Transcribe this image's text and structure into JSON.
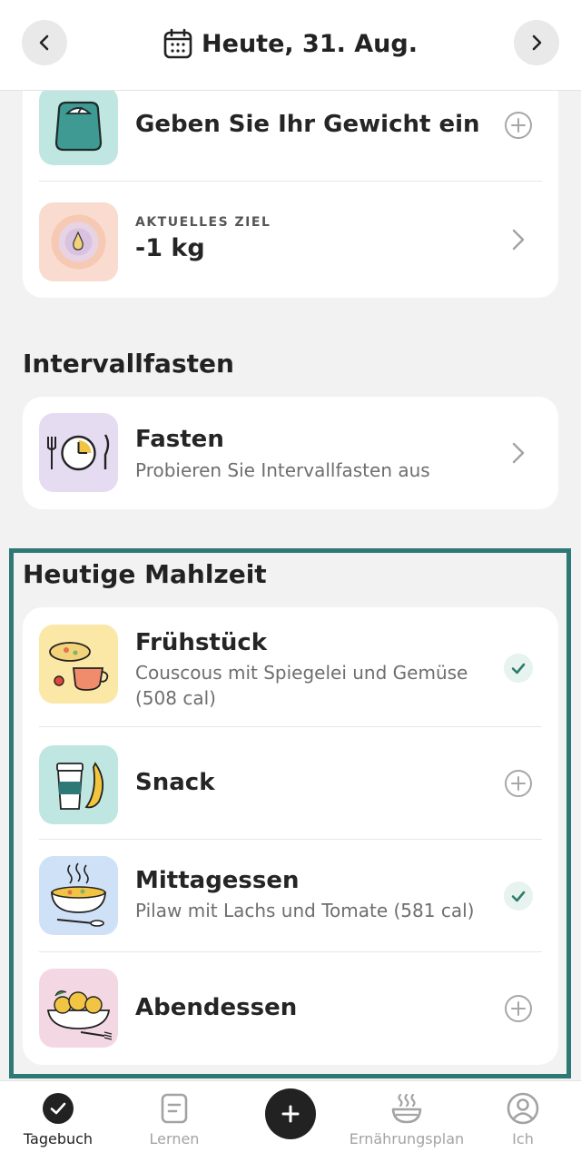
{
  "header": {
    "date_label": "Heute, 31. Aug."
  },
  "weight": {
    "enter_label": "Geben Sie Ihr Gewicht ein",
    "goal_kicker": "AKTUELLES ZIEL",
    "goal_value": "-1 kg"
  },
  "fasting": {
    "section_title": "Intervallfasten",
    "title": "Fasten",
    "subtitle": "Probieren Sie Intervallfasten aus"
  },
  "meals": {
    "section_title": "Heutige Mahlzeit",
    "items": [
      {
        "title": "Frühstück",
        "subtitle": "Couscous mit Spiegelei und Gemüse (508 cal)",
        "logged": true
      },
      {
        "title": "Snack",
        "subtitle": "",
        "logged": false
      },
      {
        "title": "Mittagessen",
        "subtitle": "Pilaw mit Lachs und Tomate (581 cal)",
        "logged": true
      },
      {
        "title": "Abendessen",
        "subtitle": "",
        "logged": false
      }
    ]
  },
  "tabbar": {
    "items": [
      {
        "label": "Tagebuch",
        "icon": "check-circle-icon",
        "active": true
      },
      {
        "label": "Lernen",
        "icon": "document-icon",
        "active": false
      },
      {
        "label": "",
        "icon": "plus-icon",
        "active": false
      },
      {
        "label": "Ernährungsplan",
        "icon": "bowl-icon",
        "active": false
      },
      {
        "label": "Ich",
        "icon": "user-icon",
        "active": false
      }
    ]
  },
  "colors": {
    "accent": "#2e7876",
    "check": "#2e7d6c",
    "teal_tile": "#bfe6e1",
    "peach_tile": "#f9dccf",
    "lavender_tile": "#e6dcf1",
    "yellow_tile": "#fbe7a6",
    "blue_tile": "#cfe1f7",
    "pink_tile": "#f3d8e3"
  }
}
